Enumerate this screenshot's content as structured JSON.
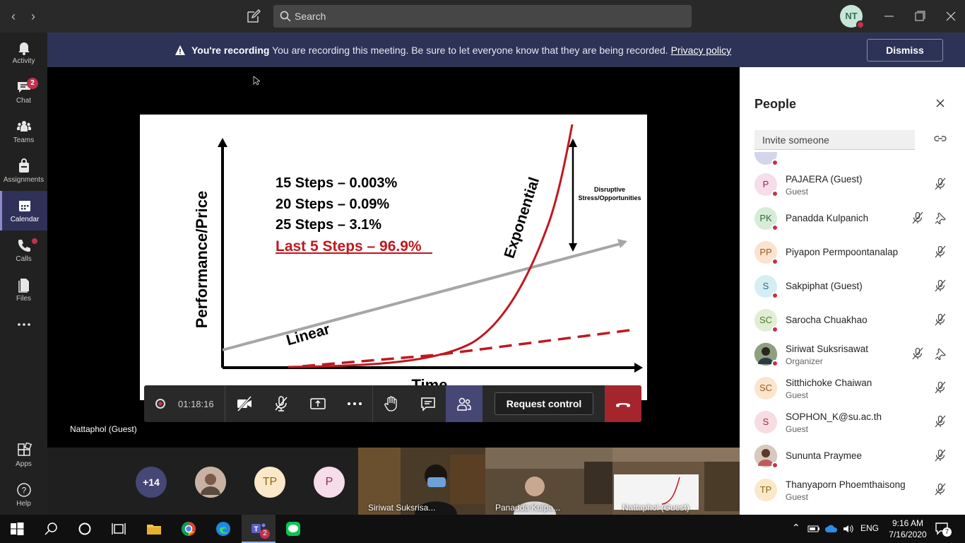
{
  "titlebar": {
    "search_placeholder": "Search",
    "user_initials": "NT"
  },
  "rail": {
    "items": [
      {
        "label": "Activity"
      },
      {
        "label": "Chat",
        "badge": "2"
      },
      {
        "label": "Teams"
      },
      {
        "label": "Assignments"
      },
      {
        "label": "Calendar"
      },
      {
        "label": "Calls"
      },
      {
        "label": "Files"
      },
      {
        "label": "Apps"
      },
      {
        "label": "Help"
      }
    ]
  },
  "banner": {
    "title": "You're recording",
    "message": "You are recording this meeting. Be sure to let everyone know that they are being recorded.",
    "link": "Privacy policy",
    "dismiss_label": "Dismiss"
  },
  "slide": {
    "ylabel": "Performance/Price",
    "xlabel": "Time",
    "lines": [
      "15 Steps – 0.003%",
      "20 Steps – 0.09%",
      "25 Steps – 3.1%"
    ],
    "highlight": "Last 5 Steps – 96.9%",
    "linear_label": "Linear",
    "exponential_label": "Exponential",
    "annotation_line1": "Disruptive",
    "annotation_line2": "Stress/Opportunities",
    "colors": {
      "exponential": "#c0181f",
      "linear": "#a6a6a6"
    }
  },
  "stage": {
    "presenter": "Nattaphol (Guest)"
  },
  "controls": {
    "timer": "01:18:16",
    "request_label": "Request control"
  },
  "strip": {
    "overflow": "+14",
    "avatars": [
      "TP",
      "P"
    ],
    "tiles": [
      {
        "name": "Siriwat Suksrisa..."
      },
      {
        "name": "Panadda Kulpa..."
      },
      {
        "name": "Nattaphol (Guest)"
      }
    ]
  },
  "people": {
    "title": "People",
    "invite_placeholder": "Invite someone",
    "list": [
      {
        "initials": "P",
        "name": "PAJAERA (Guest)",
        "role": "Guest",
        "bg": "#f6dde9",
        "fg": "#8c2d5a"
      },
      {
        "initials": "PK",
        "name": "Panadda Kulpanich",
        "role": "",
        "bg": "#d7ecd8",
        "fg": "#2e6b34"
      },
      {
        "initials": "PP",
        "name": "Piyapon Permpoontanalap",
        "role": "",
        "bg": "#fbe3cf",
        "fg": "#9a5a1a"
      },
      {
        "initials": "S",
        "name": "Sakpiphat (Guest)",
        "role": "",
        "bg": "#d5eef3",
        "fg": "#1e6f80"
      },
      {
        "initials": "SC",
        "name": "Sarocha Chuakhao",
        "role": "",
        "bg": "#e1eed5",
        "fg": "#4f7a23"
      },
      {
        "initials": "",
        "name": "Siriwat Suksrisawat",
        "role": "Organizer",
        "bg": "#6a7a60",
        "fg": "#fff"
      },
      {
        "initials": "SC",
        "name": "Sitthichoke Chaiwan",
        "role": "Guest",
        "bg": "#fbe5cc",
        "fg": "#9a5a1a"
      },
      {
        "initials": "S",
        "name": "SOPHON_K@su.ac.th",
        "role": "Guest",
        "bg": "#f6dde3",
        "fg": "#8c2d40"
      },
      {
        "initials": "",
        "name": "Sununta Praymee",
        "role": "",
        "bg": "#b49a8a",
        "fg": "#fff"
      },
      {
        "initials": "TP",
        "name": "Thanyaporn Phoemthaisong",
        "role": "Guest",
        "bg": "#fbe8c8",
        "fg": "#8a6a1a"
      }
    ]
  },
  "taskbar": {
    "lang": "ENG",
    "time": "9:16 AM",
    "date": "7/16/2020",
    "teams_badge": "2",
    "notif_count": "7"
  }
}
